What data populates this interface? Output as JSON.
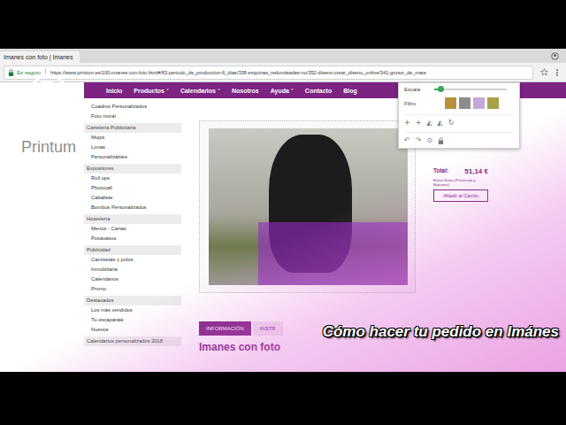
{
  "browser": {
    "tab_title": "Imanes con foto | Imanes",
    "security": "Es seguro",
    "url": "https://www.printum.es/100-imanes-con-foto.html#/63-periodo_de_produccion-6_dias/338-esquinas_redondeadas-no/352-diseno-crear_diseno_online/341-grosor_de_mate"
  },
  "logo": {
    "text": "Printum"
  },
  "nav_caret": "˅",
  "nav": [
    {
      "label": "Inicio",
      "dropdown": false
    },
    {
      "label": "Productos",
      "dropdown": true
    },
    {
      "label": "Calendarios",
      "dropdown": true
    },
    {
      "label": "Nosotros",
      "dropdown": false
    },
    {
      "label": "Ayuda",
      "dropdown": true
    },
    {
      "label": "Contacto",
      "dropdown": false
    },
    {
      "label": "Blog",
      "dropdown": false
    }
  ],
  "sidebar": [
    {
      "label": "Cuadros Personalizados",
      "kind": "item"
    },
    {
      "label": "Foto mural",
      "kind": "item"
    },
    {
      "label": "Cartelería Publicitaria",
      "kind": "header"
    },
    {
      "label": "Mupis",
      "kind": "item"
    },
    {
      "label": "Lonas",
      "kind": "item"
    },
    {
      "label": "Personalizables",
      "kind": "item"
    },
    {
      "label": "Expositores",
      "kind": "header"
    },
    {
      "label": "Roll ups",
      "kind": "item"
    },
    {
      "label": "Photocall",
      "kind": "item"
    },
    {
      "label": "Caballete",
      "kind": "item"
    },
    {
      "label": "Bombos Personalizados",
      "kind": "item"
    },
    {
      "label": "Hostelería",
      "kind": "header"
    },
    {
      "label": "Menús - Cartas",
      "kind": "item"
    },
    {
      "label": "Posavasos",
      "kind": "item"
    },
    {
      "label": "Publicidad",
      "kind": "header"
    },
    {
      "label": "Camisetas y polos",
      "kind": "item"
    },
    {
      "label": "Inmobiliaria",
      "kind": "item"
    },
    {
      "label": "Calendarios",
      "kind": "item"
    },
    {
      "label": "Promo",
      "kind": "item"
    },
    {
      "label": "Destacados",
      "kind": "header"
    },
    {
      "label": "Los más vendidos",
      "kind": "item"
    },
    {
      "label": "Tu escaparate",
      "kind": "item"
    },
    {
      "label": "Nuevos",
      "kind": "item"
    },
    {
      "label": "Calendarios personalizados 2018",
      "kind": "header"
    }
  ],
  "editor": {
    "scale_label": "Escala",
    "level": 0.08,
    "filter_label": "Filtro",
    "filters": [
      {
        "color": "#b8923c"
      },
      {
        "color": "#8d8d8d"
      },
      {
        "color": "#c6a8d8"
      },
      {
        "color": "#a9a04a"
      }
    ],
    "tools": [
      "+",
      "+",
      "◭",
      "◭",
      "↻"
    ],
    "history": [
      "↶",
      "↷",
      "⊙"
    ]
  },
  "price": {
    "total_label": "Total:",
    "total": "51,14 €",
    "shipping": "Envío Gratis (Península y Baleares)",
    "button": "Añadir al Carrito"
  },
  "tabs": [
    {
      "label": "INFORMACIÓN",
      "selected": true
    },
    {
      "label": "INSTR",
      "selected": false
    }
  ],
  "heading": "Imanes con foto",
  "caption": "Cómo hacer tu pedido en Imánes"
}
